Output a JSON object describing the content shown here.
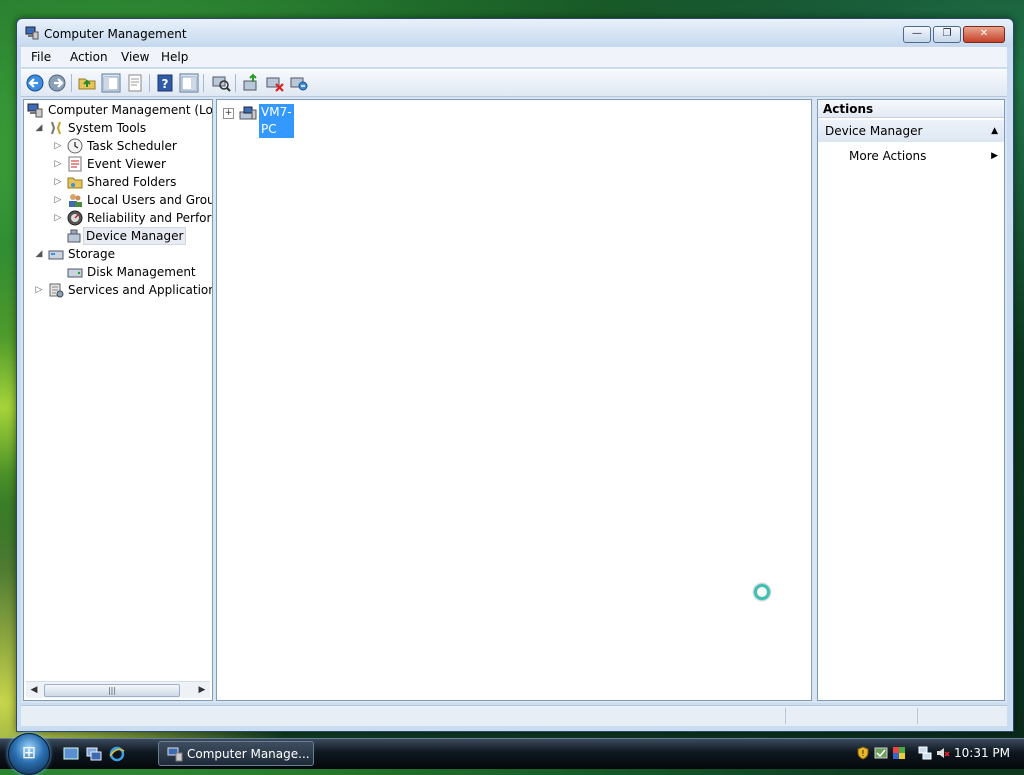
{
  "window": {
    "title": "Computer Management",
    "minimize_label": "—",
    "maximize_label": "❐",
    "close_label": "✕"
  },
  "menu": [
    "File",
    "Action",
    "View",
    "Help"
  ],
  "toolbar": {
    "icons": [
      "back-icon",
      "forward-icon",
      "up-folder-icon",
      "show-hide-console-tree-icon",
      "properties-icon",
      "help-icon",
      "show-hide-action-pane-icon",
      "scan-hardware-icon",
      "update-driver-icon",
      "disable-device-icon",
      "uninstall-device-icon"
    ]
  },
  "tree": {
    "root": "Computer Management (Local",
    "system_tools": "System Tools",
    "task_scheduler": "Task Scheduler",
    "event_viewer": "Event Viewer",
    "shared_folders": "Shared Folders",
    "local_users": "Local Users and Groups",
    "reliability": "Reliability and Performa",
    "device_manager": "Device Manager",
    "storage": "Storage",
    "disk_management": "Disk Management",
    "services": "Services and Applications"
  },
  "center": {
    "computer_node": "VM7-PC",
    "expander": "+"
  },
  "actions": {
    "header": "Actions",
    "section": "Device Manager",
    "more_actions": "More Actions"
  },
  "taskbar": {
    "start_glyph": "⊞",
    "task_label": "Computer Manage...",
    "clock": "10:31 PM"
  },
  "colors": {
    "selection": "#3399ff",
    "window_frame": "#c9dcf0"
  }
}
